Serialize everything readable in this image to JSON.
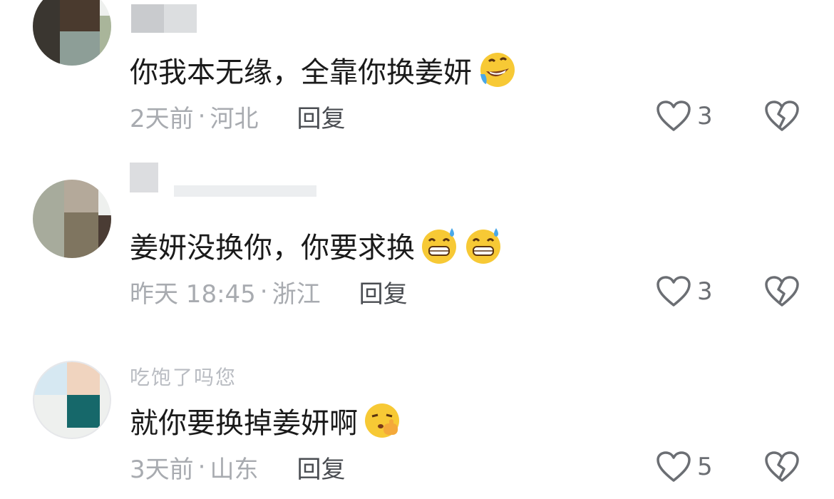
{
  "comments": [
    {
      "username": "",
      "content": "你我本无缘，全靠你换姜妍",
      "emoji": "rolling-laughing-emoji",
      "time": "2天前",
      "location": "河北",
      "reply_label": "回复",
      "likes": "3"
    },
    {
      "username": "",
      "content": "姜妍没换你，你要求换",
      "emoji": "grinning-sweat-emoji",
      "time": "昨天 18:45",
      "location": "浙江",
      "reply_label": "回复",
      "likes": "3"
    },
    {
      "username": "吃饱了吗您",
      "content": "就你要换掉姜妍啊",
      "emoji": "shushing-face-emoji",
      "time": "3天前",
      "location": "山东",
      "reply_label": "回复",
      "likes": "5"
    }
  ],
  "separator": "·",
  "colors": {
    "text": "#1a1a1a",
    "meta": "#a8abb0",
    "reply": "#4a4d52",
    "icon": "#6b6e73"
  }
}
